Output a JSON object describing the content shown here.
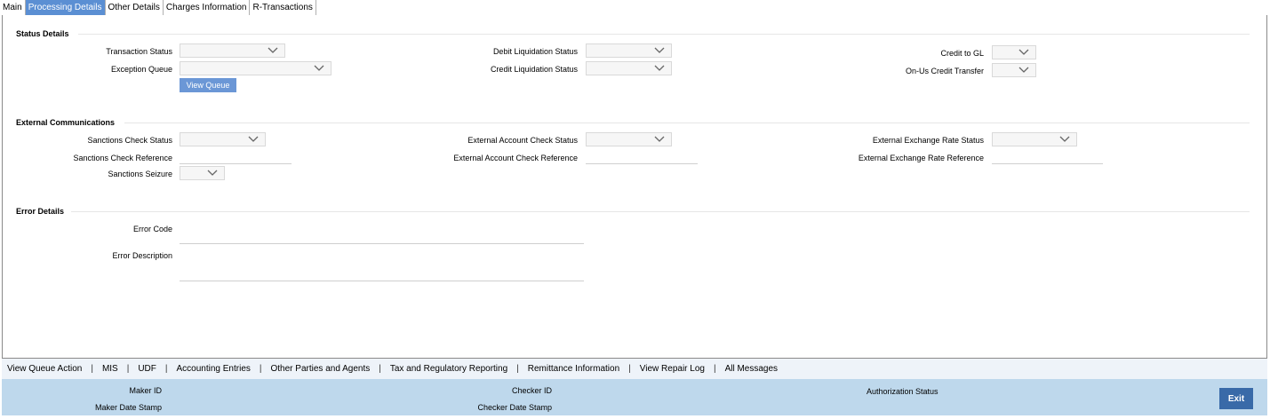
{
  "tabs": [
    {
      "label": "Main"
    },
    {
      "label": "Processing Details"
    },
    {
      "label": "Other Details"
    },
    {
      "label": "Charges Information"
    },
    {
      "label": "R-Transactions"
    }
  ],
  "status_details": {
    "title": "Status Details",
    "transaction_status": "Transaction Status",
    "exception_queue": "Exception Queue",
    "view_queue_button": "View Queue",
    "debit_liquidation_status": "Debit Liquidation Status",
    "credit_liquidation_status": "Credit Liquidation Status",
    "credit_to_gl": "Credit to GL",
    "on_us_credit_transfer": "On-Us Credit Transfer"
  },
  "external_communications": {
    "title": "External Communications",
    "sanctions_check_status": "Sanctions Check Status",
    "sanctions_check_reference": "Sanctions Check Reference",
    "sanctions_seizure": "Sanctions Seizure",
    "external_account_check_status": "External Account Check Status",
    "external_account_check_reference": "External Account Check Reference",
    "external_exchange_rate_status": "External Exchange Rate Status",
    "external_exchange_rate_reference": "External Exchange Rate Reference"
  },
  "error_details": {
    "title": "Error Details",
    "error_code": "Error Code",
    "error_description": "Error Description"
  },
  "footer_links": [
    "View Queue Action",
    "MIS",
    "UDF",
    "Accounting Entries",
    "Other Parties and Agents",
    "Tax and Regulatory Reporting",
    "Remittance Information",
    "View Repair Log",
    "All Messages"
  ],
  "audit": {
    "maker_id": "Maker ID",
    "maker_date_stamp": "Maker Date Stamp",
    "checker_id": "Checker ID",
    "checker_date_stamp": "Checker Date Stamp",
    "authorization_status": "Authorization Status",
    "exit_button": "Exit"
  },
  "icons": {
    "dropdown": "chevron-down-icon"
  },
  "colors": {
    "active_tab": "#5b8fd3",
    "button": "#6b97d6",
    "audit_bar": "#bed8ec",
    "exit_button": "#396aa8"
  }
}
